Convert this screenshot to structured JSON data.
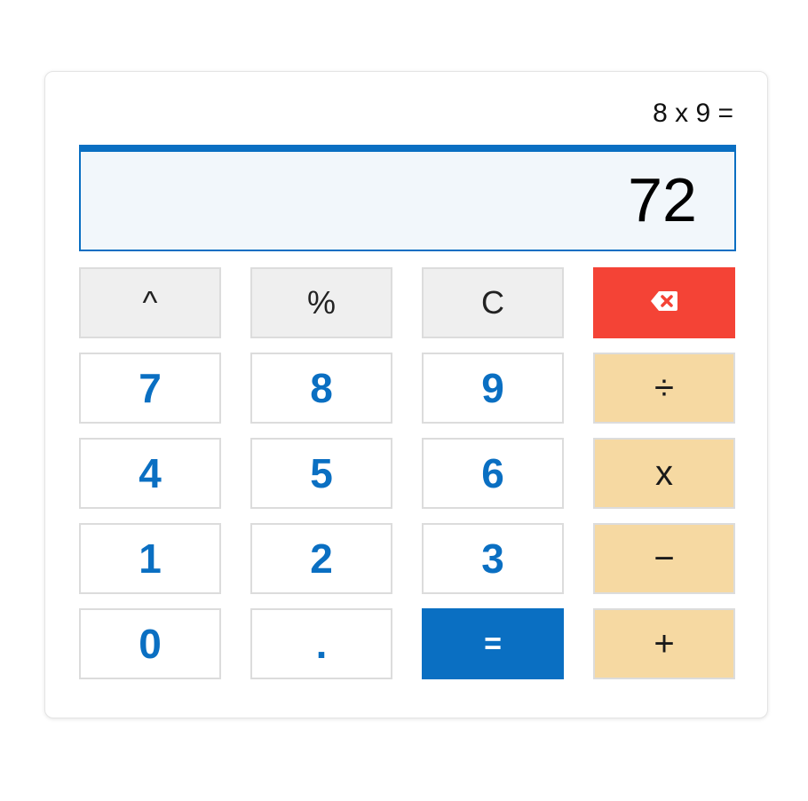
{
  "calculator": {
    "expression": "8 x 9 =",
    "display_value": "72",
    "keys": {
      "power": "^",
      "percent": "%",
      "clear": "C",
      "backspace_icon": "backspace-icon",
      "seven": "7",
      "eight": "8",
      "nine": "9",
      "divide": "÷",
      "four": "4",
      "five": "5",
      "six": "6",
      "multiply": "x",
      "one": "1",
      "two": "2",
      "three": "3",
      "subtract": "−",
      "zero": "0",
      "decimal": ".",
      "equals": "=",
      "add": "+"
    },
    "colors": {
      "accent": "#0a6fc2",
      "backspace": "#f44336",
      "operator": "#f6d9a2",
      "function": "#efefef"
    }
  }
}
